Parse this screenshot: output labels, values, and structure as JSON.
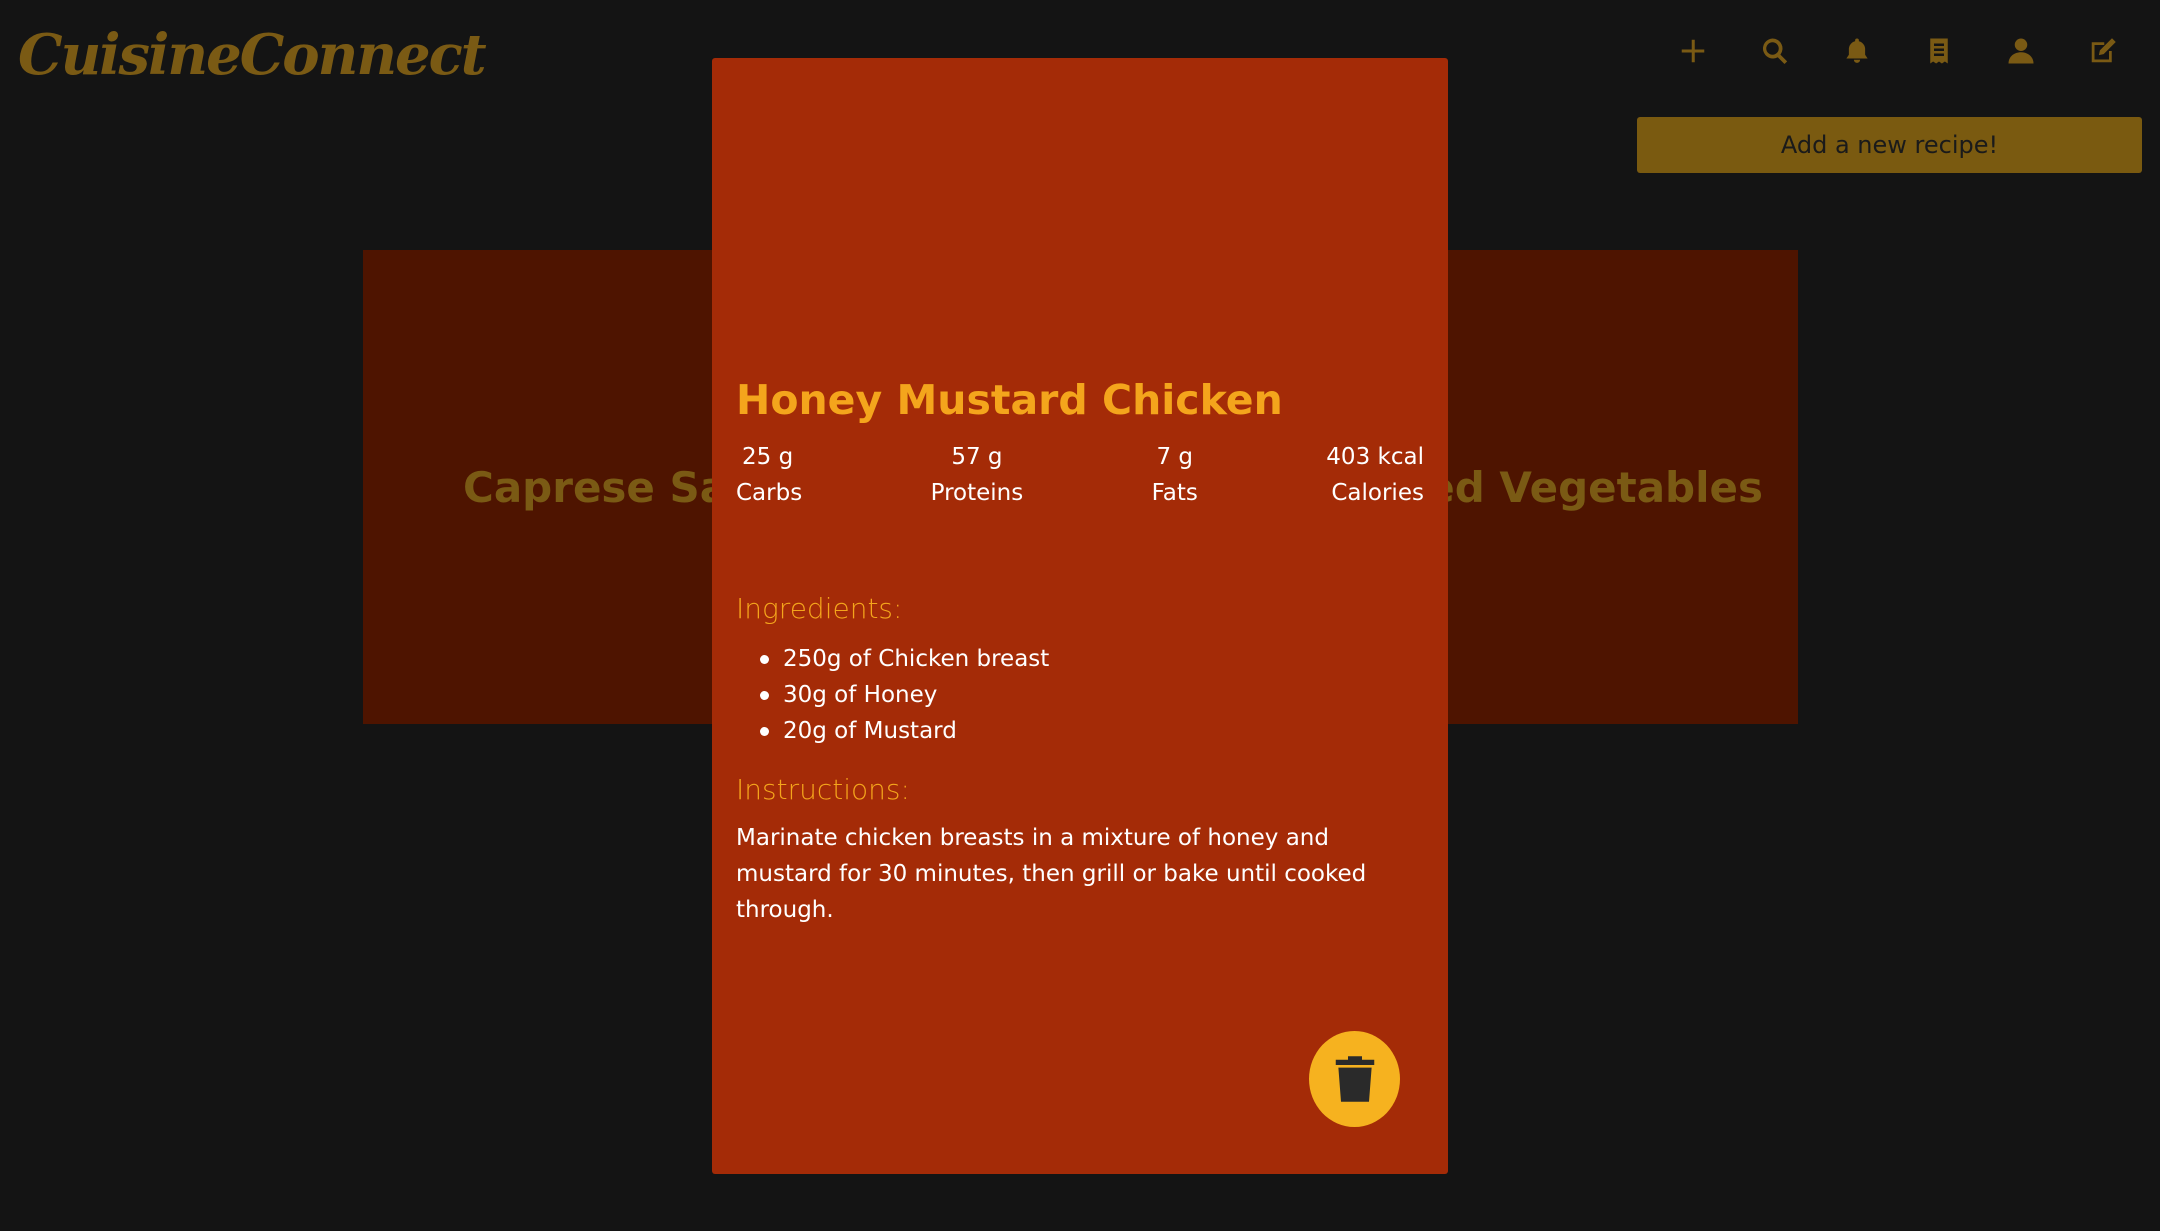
{
  "app": {
    "logo": "CuisineConnect"
  },
  "header": {
    "icons": [
      "plus-icon",
      "search-icon",
      "bell-icon",
      "receipt-icon",
      "user-icon",
      "edit-icon"
    ],
    "add_recipe_label": "Add a new recipe!"
  },
  "carousel": {
    "left_card_title": "Caprese Salad",
    "right_card_title": "Stir-Fried Vegetables"
  },
  "recipe": {
    "title": "Honey Mustard Chicken",
    "macros": [
      {
        "value": "25 g",
        "label": "Carbs"
      },
      {
        "value": "57 g",
        "label": "Proteins"
      },
      {
        "value": "7 g",
        "label": "Fats"
      },
      {
        "value": "403 kcal",
        "label": "Calories"
      }
    ],
    "ingredients_heading": "Ingredients:",
    "ingredients": [
      "250g of Chicken breast",
      "30g of Honey",
      "20g of Mustard"
    ],
    "instructions_heading": "Instructions:",
    "instructions": "Marinate chicken breasts in a mixture of honey and mustard for 30 minutes, then grill or bake until cooked through."
  },
  "colors": {
    "background": "#141414",
    "modal": "#a42b07",
    "accent": "#f4a51c",
    "dim_accent": "#7a5a14",
    "bg_card": "#4e1400"
  }
}
